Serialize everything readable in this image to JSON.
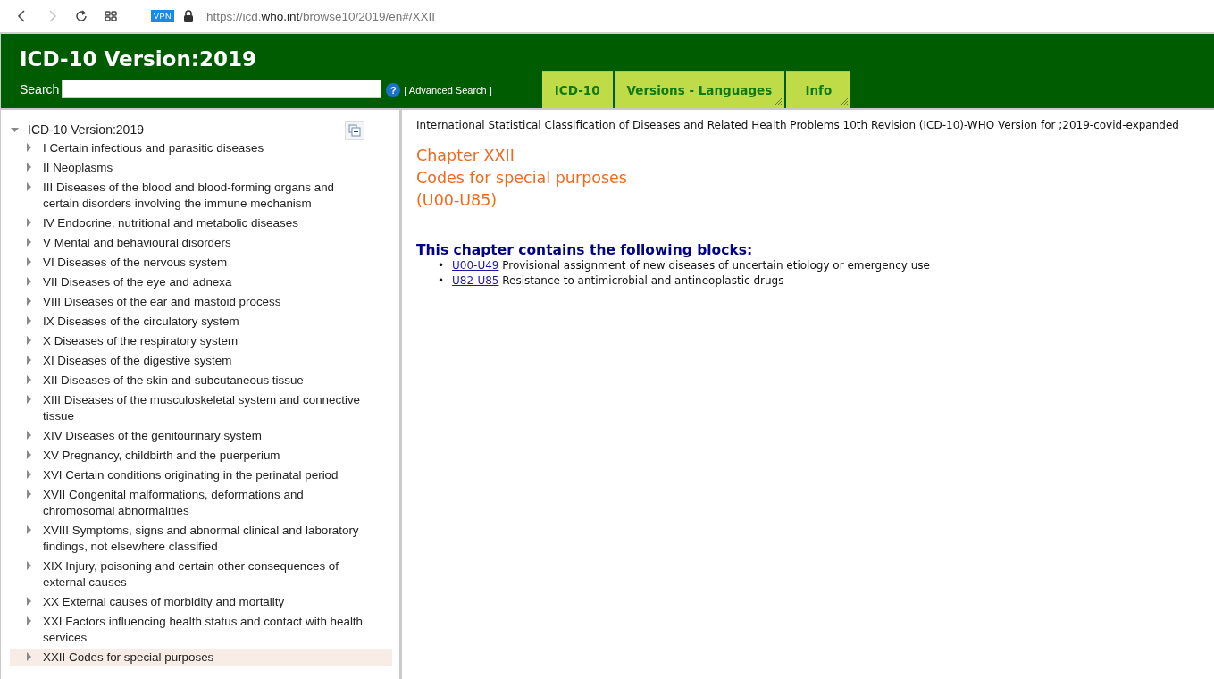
{
  "browser": {
    "back_disabled": false,
    "forward_disabled": true,
    "vpn": "VPN",
    "url": "https://icd.**who.int**/browse10/2019/en#/XXII"
  },
  "header": {
    "title": "ICD-10 Version:2019",
    "search_label": "Search",
    "help": "?",
    "advanced_search": "[ Advanced Search ]",
    "tabs": [
      {
        "label": "ICD-10",
        "grip": false
      },
      {
        "label": "Versions - Languages",
        "grip": true
      },
      {
        "label": "Info",
        "grip": true
      }
    ]
  },
  "tree": {
    "label": "ICD-10 Version:2019",
    "expanded": true,
    "children": [
      {
        "label": "I Certain infectious and parasitic diseases",
        "expanded": false,
        "selected": false
      },
      {
        "label": "II Neoplasms",
        "expanded": false,
        "selected": false
      },
      {
        "label": "III Diseases of the blood and blood-forming organs and certain disorders involving the immune mechanism",
        "expanded": false,
        "selected": false
      },
      {
        "label": "IV Endocrine, nutritional and metabolic diseases",
        "expanded": false,
        "selected": false
      },
      {
        "label": "V Mental and behavioural disorders",
        "expanded": false,
        "selected": false
      },
      {
        "label": "VI Diseases of the nervous system",
        "expanded": false,
        "selected": false
      },
      {
        "label": "VII Diseases of the eye and adnexa",
        "expanded": false,
        "selected": false
      },
      {
        "label": "VIII Diseases of the ear and mastoid process",
        "expanded": false,
        "selected": false
      },
      {
        "label": "IX Diseases of the circulatory system",
        "expanded": false,
        "selected": false
      },
      {
        "label": "X Diseases of the respiratory system",
        "expanded": false,
        "selected": false
      },
      {
        "label": "XI Diseases of the digestive system",
        "expanded": false,
        "selected": false
      },
      {
        "label": "XII Diseases of the skin and subcutaneous tissue",
        "expanded": false,
        "selected": false
      },
      {
        "label": "XIII Diseases of the musculoskeletal system and connective tissue",
        "expanded": false,
        "selected": false
      },
      {
        "label": "XIV Diseases of the genitourinary system",
        "expanded": false,
        "selected": false
      },
      {
        "label": "XV Pregnancy, childbirth and the puerperium",
        "expanded": false,
        "selected": false
      },
      {
        "label": "XVI Certain conditions originating in the perinatal period",
        "expanded": false,
        "selected": false
      },
      {
        "label": "XVII Congenital malformations, deformations and chromosomal abnormalities",
        "expanded": false,
        "selected": false
      },
      {
        "label": "XVIII Symptoms, signs and abnormal clinical and laboratory findings, not elsewhere classified",
        "expanded": false,
        "selected": false
      },
      {
        "label": "XIX Injury, poisoning and certain other consequences of external causes",
        "expanded": false,
        "selected": false
      },
      {
        "label": "XX External causes of morbidity and mortality",
        "expanded": false,
        "selected": false
      },
      {
        "label": "XXI Factors influencing health status and contact with health services",
        "expanded": false,
        "selected": false
      },
      {
        "label": "XXII Codes for special purposes",
        "expanded": false,
        "selected": true
      }
    ]
  },
  "content": {
    "classification": "International Statistical Classification of Diseases and Related Health Problems 10th Revision (ICD-10)-WHO Version for ;2019-covid-expanded",
    "chapter": "Chapter XXII",
    "chapter_title": "Codes for special purposes",
    "range": "(U00-U85)",
    "blocks_heading": "This chapter contains the following blocks:",
    "blocks": [
      {
        "marker": "•",
        "code": "U00-U49",
        "title": "Provisional assignment of new diseases of uncertain etiology or emergency use"
      },
      {
        "marker": "•",
        "code": "U82-U85",
        "title": "Resistance to antimicrobial and antineoplastic drugs"
      }
    ]
  }
}
